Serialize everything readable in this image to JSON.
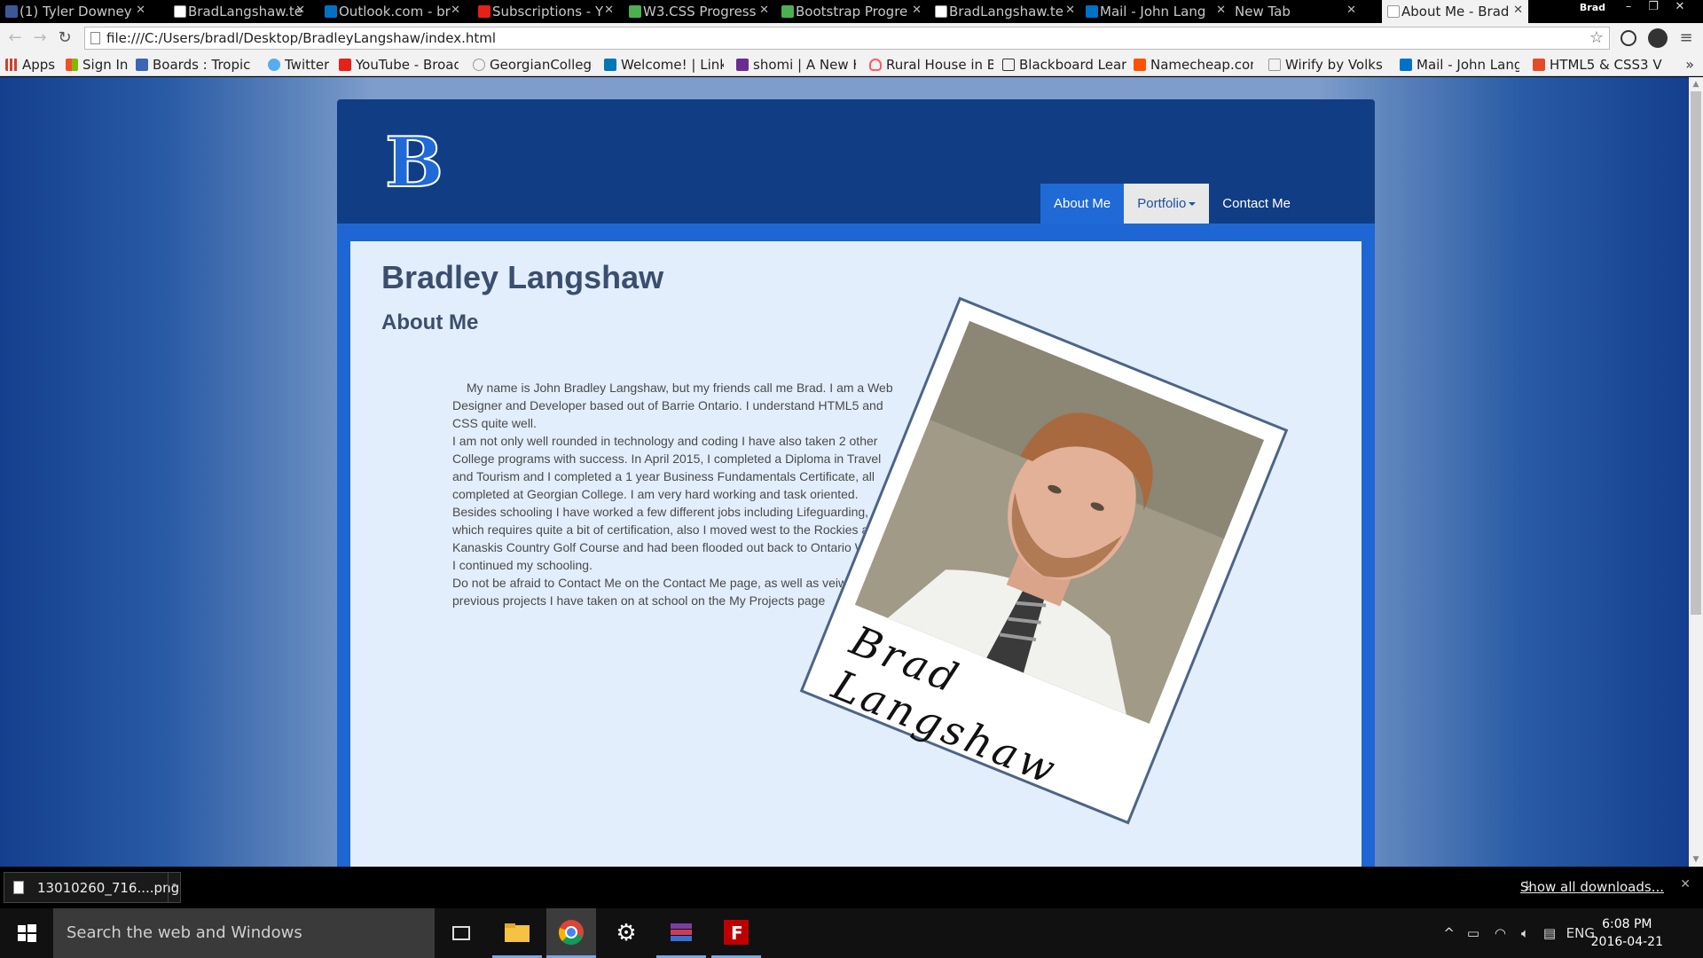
{
  "browser": {
    "tabs": [
      {
        "title": "(1) Tyler Downey",
        "icon_color": "#3b5998",
        "icon": "facebook-icon"
      },
      {
        "title": "BradLangshaw.te",
        "icon_color": "#cccccc",
        "icon": "page-icon"
      },
      {
        "title": "Outlook.com - br",
        "icon_color": "#0072c6",
        "icon": "outlook-icon"
      },
      {
        "title": "Subscriptions - Y",
        "icon_color": "#e62117",
        "icon": "youtube-icon"
      },
      {
        "title": "W3.CSS Progress",
        "icon_color": "#4caf50",
        "icon": "w3-icon"
      },
      {
        "title": "Bootstrap Progre",
        "icon_color": "#4caf50",
        "icon": "w3-icon"
      },
      {
        "title": "BradLangshaw.te",
        "icon_color": "#cccccc",
        "icon": "page-icon"
      },
      {
        "title": "Mail - John Lang",
        "icon_color": "#0072c6",
        "icon": "mail-icon"
      },
      {
        "title": "New Tab",
        "icon_color": "#000000",
        "icon": "none"
      },
      {
        "title": "About Me - Brad",
        "icon_color": "#cccccc",
        "icon": "page-icon",
        "active": true
      }
    ],
    "profile_name": "Brad",
    "url": "file:///C:/Users/bradl/Desktop/BradleyLangshaw/index.html",
    "bookmarks": [
      {
        "label": "Apps",
        "icon": "apps-grid-icon",
        "color": "#d23f31"
      },
      {
        "label": "Sign In",
        "icon": "windows-icon",
        "color": "#f25022"
      },
      {
        "label": "Boards : Tropical",
        "icon": "boards-icon",
        "color": "#3a66b4"
      },
      {
        "label": "Twitter",
        "icon": "twitter-icon",
        "color": "#55acee"
      },
      {
        "label": "YouTube - Broadc",
        "icon": "youtube-icon",
        "color": "#e62117"
      },
      {
        "label": "GeorgianCollege/",
        "icon": "globe-icon",
        "color": "#dddddd"
      },
      {
        "label": "Welcome! | Linke",
        "icon": "linkedin-icon",
        "color": "#0077b5"
      },
      {
        "label": "shomi | A New Ki",
        "icon": "shomi-icon",
        "color": "#6b2c91"
      },
      {
        "label": "Rural House in Ba",
        "icon": "airbnb-icon",
        "color": "#ff5a5f"
      },
      {
        "label": "Blackboard Learn",
        "icon": "blackboard-icon",
        "color": "#333333"
      },
      {
        "label": "Namecheap.com",
        "icon": "namecheap-icon",
        "color": "#ff5100"
      },
      {
        "label": "Wirify by Volks",
        "icon": "wirify-icon",
        "color": "#dddddd"
      },
      {
        "label": "Mail - John Lang",
        "icon": "mail-icon",
        "color": "#0072c6"
      },
      {
        "label": "HTML5 & CSS3 V",
        "icon": "html5-icon",
        "color": "#e34c26"
      }
    ]
  },
  "site": {
    "logo_letter": "B",
    "nav": [
      {
        "label": "About Me",
        "state": "active"
      },
      {
        "label": "Portfolio",
        "state": "dropdown"
      },
      {
        "label": "Contact Me",
        "state": "normal"
      }
    ],
    "page_title": "Bradley Langshaw",
    "section_title": "About Me",
    "bio": [
      "My name is John Bradley Langshaw, but my friends call me Brad. I am a Web Designer and Developer based out of Barrie Ontario. I understand HTML5 and CSS quite well.",
      "I am not only well rounded in technology and coding I have also taken 2 other College programs with success. In April 2015, I completed a Diploma in Travel and Tourism and I completed a 1 year Business Fundamentals Certificate, all completed at Georgian College. I am very hard working and task oriented.",
      "Besides schooling I have worked a few different jobs including Lifeguarding, which requires quite a bit of certification, also I moved west to the Rockies at Kanaskis Country Golf Course and had been flooded out back to Ontario Where I continued my schooling.",
      "Do not be afraid to Contact Me on the Contact Me page, as well as veiw my previous projects I have taken on at school on the My Projects page"
    ],
    "photo_caption": "Brad Langshaw"
  },
  "downloads": {
    "file_name": "13010260_716....png",
    "show_all": "Show all downloads..."
  },
  "taskbar": {
    "search_placeholder": "Search the web and Windows",
    "language": "ENG",
    "time": "6:08 PM",
    "date": "2016-04-21"
  },
  "colors": {
    "header_bg": "#113d85",
    "nav_active": "#1f6ad6",
    "frame_bg": "#1e66d3",
    "content_bg": "#e2eefb"
  }
}
